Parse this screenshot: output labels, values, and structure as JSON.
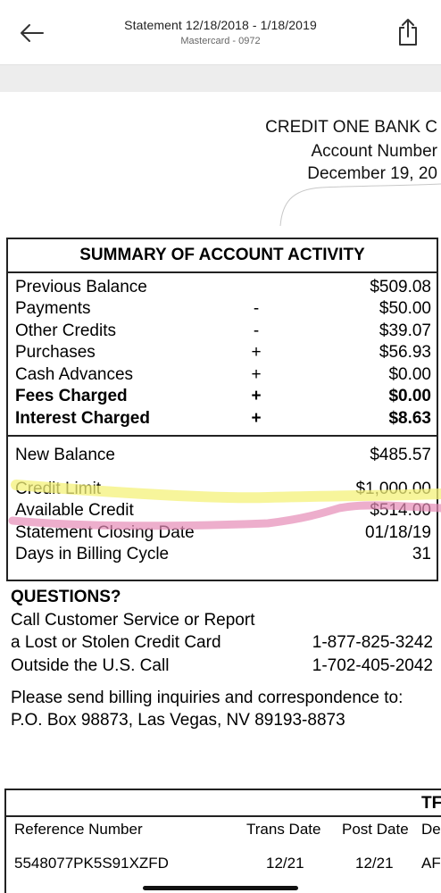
{
  "nav": {
    "title": "Statement 12/18/2018 - 1/18/2019",
    "subtitle": "Mastercard - 0972",
    "back_icon": "back-arrow-icon",
    "share_icon": "share-icon"
  },
  "doc_header": {
    "bank": "CREDIT ONE BANK C",
    "account": "Account Number",
    "date": "December 19, 20"
  },
  "summary": {
    "title": "SUMMARY OF ACCOUNT ACTIVITY",
    "rows": [
      {
        "label": "Previous Balance",
        "op": "",
        "value": "$509.08"
      },
      {
        "label": "Payments",
        "op": "-",
        "value": "$50.00"
      },
      {
        "label": "Other Credits",
        "op": "-",
        "value": "$39.07"
      },
      {
        "label": "Purchases",
        "op": "+",
        "value": "$56.93"
      },
      {
        "label": "Cash Advances",
        "op": "+",
        "value": "$0.00"
      },
      {
        "label": "Fees Charged",
        "op": "+",
        "value": "$0.00"
      },
      {
        "label": "Interest Charged",
        "op": "+",
        "value": "$8.63"
      }
    ],
    "bottom_rows": [
      {
        "label": "New Balance",
        "value": "$485.57"
      },
      {
        "label": "Credit Limit",
        "value": "$1,000.00"
      },
      {
        "label": "Available Credit",
        "value": "$514.00"
      },
      {
        "label": "Statement Closing Date",
        "value": "01/18/19"
      },
      {
        "label": "Days in Billing Cycle",
        "value": "31"
      }
    ]
  },
  "questions": {
    "heading": "QUESTIONS?",
    "line1": "Call Customer Service or Report",
    "line2": "a Lost or Stolen Credit Card",
    "phone1": "1-877-825-3242",
    "line3": "Outside the U.S. Call",
    "phone2": "1-702-405-2042",
    "mail1": "Please send billing inquiries and correspondence to:",
    "mail2": "P.O. Box 98873, Las Vegas, NV 89193-8873"
  },
  "transactions": {
    "corner": "TF",
    "headers": [
      "Reference Number",
      "Trans Date",
      "Post Date",
      "De"
    ],
    "first_ref": "5548077PK5S91XZFD",
    "first_trans": "12/21",
    "first_post": "12/21",
    "first_desc": "AF"
  },
  "highlight_colors": {
    "yellow": "#f4f27a",
    "pink": "#e58bb6"
  }
}
